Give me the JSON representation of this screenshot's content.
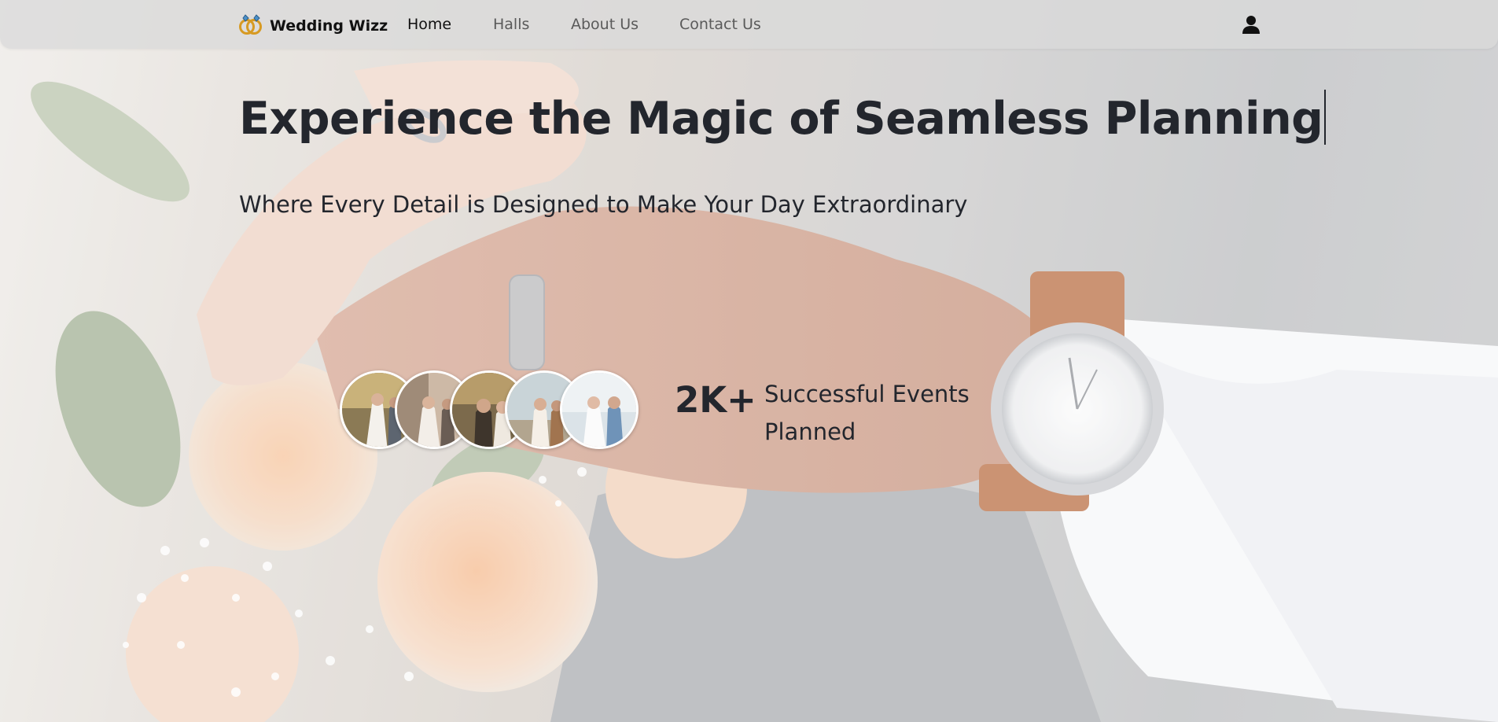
{
  "brand": {
    "name": "Wedding Wizz",
    "logo_icon": "wedding-rings-icon"
  },
  "nav": {
    "links": [
      {
        "label": "Home",
        "active": true
      },
      {
        "label": "Halls",
        "active": false
      },
      {
        "label": "About Us",
        "active": false
      },
      {
        "label": "Contact Us",
        "active": false
      }
    ],
    "account_icon": "user-icon"
  },
  "hero": {
    "title": "Experience the Magic of Seamless Planning",
    "subtitle": "Where Every Detail is Designed to Make Your Day Extraordinary",
    "background_image": "couple-hands-rings-bouquet-photo"
  },
  "stats": {
    "number": "2K+",
    "label": "Successful Events Planned",
    "avatars": [
      {
        "name": "couple-photo-1"
      },
      {
        "name": "couple-photo-2"
      },
      {
        "name": "couple-photo-3"
      },
      {
        "name": "couple-photo-4"
      },
      {
        "name": "couple-photo-5"
      }
    ]
  },
  "colors": {
    "text": "#23262d",
    "navbar": "#dadada",
    "nav_inactive": "#5a5a5a",
    "nav_active": "#111111"
  }
}
